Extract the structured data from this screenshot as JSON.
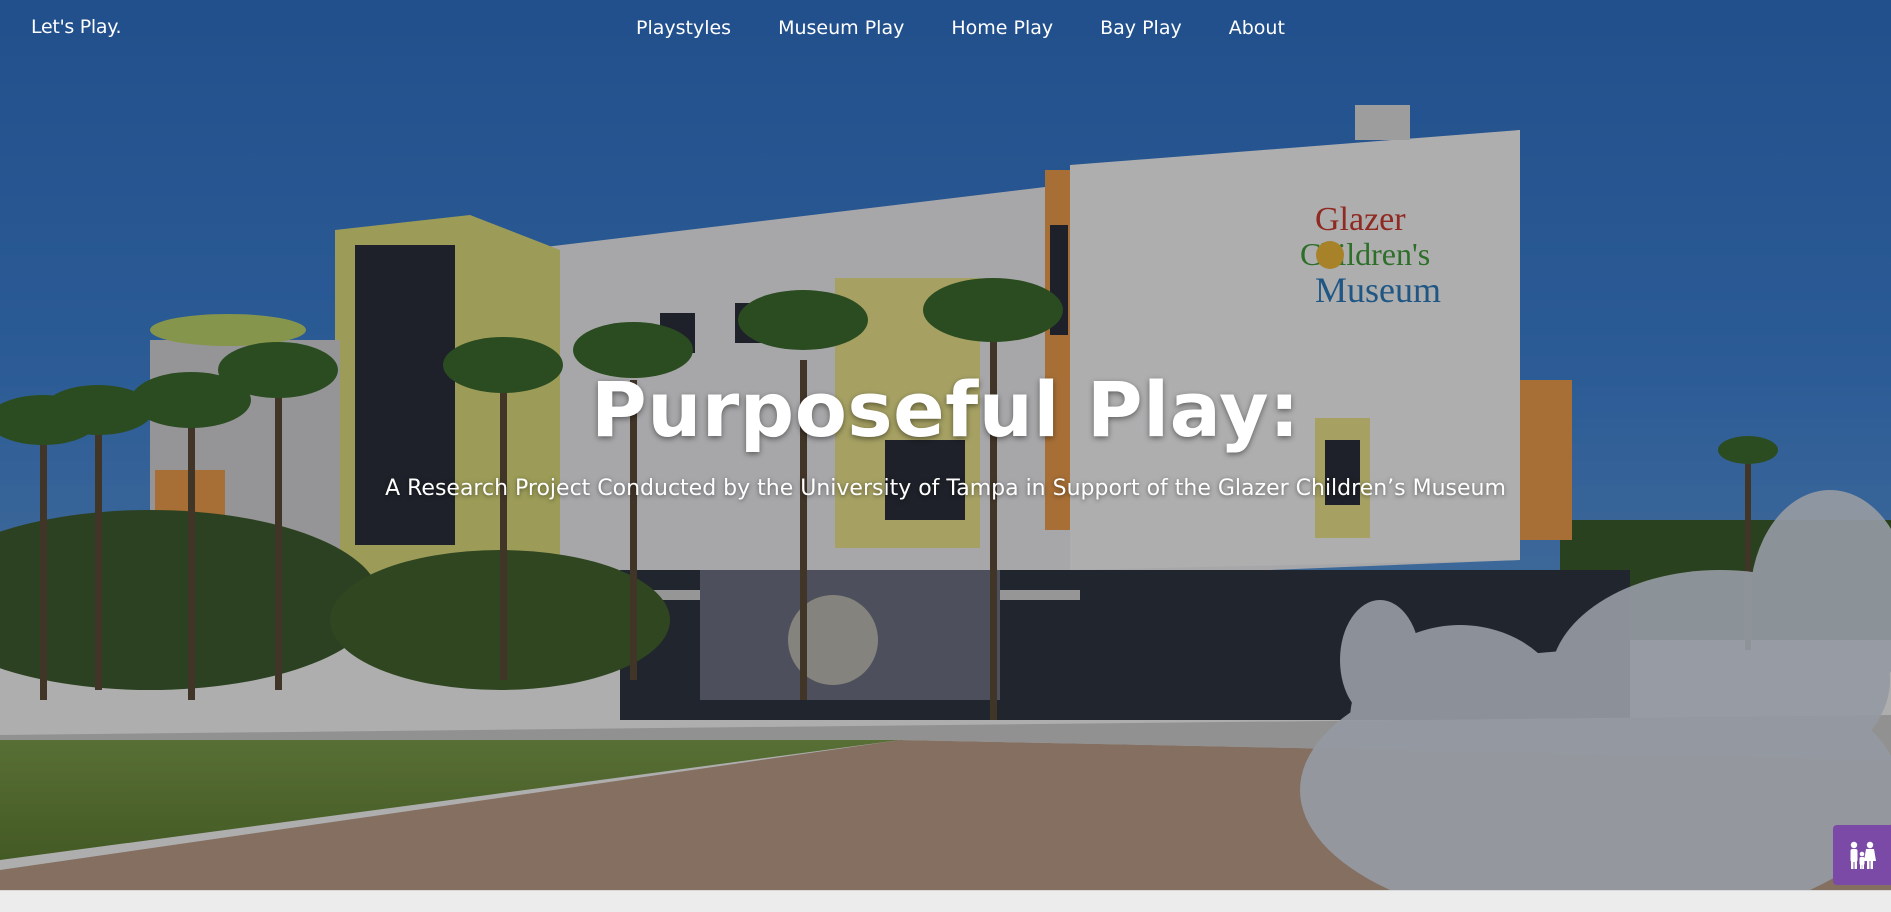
{
  "brand": {
    "label": "Let's Play."
  },
  "nav": {
    "items": [
      {
        "label": "Playstyles"
      },
      {
        "label": "Museum Play"
      },
      {
        "label": "Home Play"
      },
      {
        "label": "Bay Play"
      },
      {
        "label": "About"
      }
    ]
  },
  "hero": {
    "title": "Purposeful Play:",
    "subtitle": "A Research Project Conducted by the University of Tampa in Support of the Glazer Children’s Museum",
    "sign_lines": [
      "Glazer",
      "Children's",
      "Museum"
    ]
  },
  "accessibility_button": {
    "icon": "family-icon",
    "color": "#7a4aa6"
  }
}
